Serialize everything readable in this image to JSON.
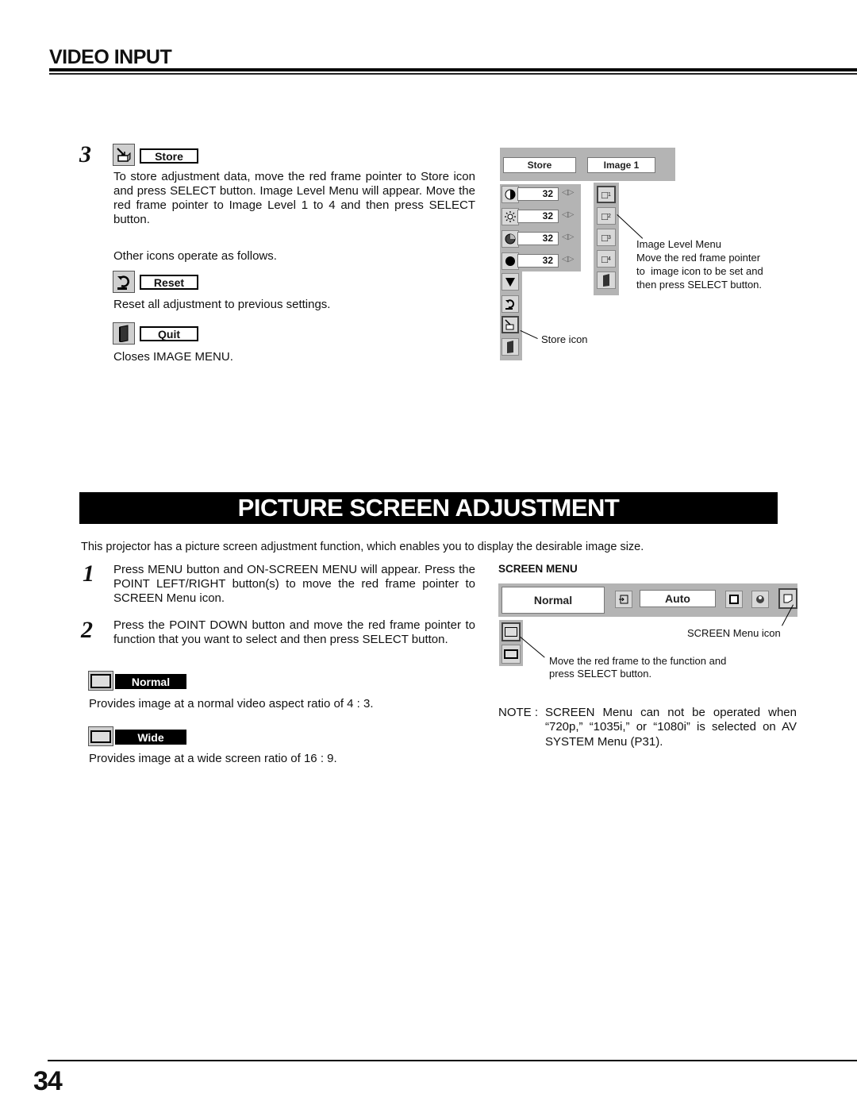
{
  "header": {
    "section_title": "VIDEO INPUT"
  },
  "store_section": {
    "step_number": "3",
    "store": {
      "icon": "store-box-icon",
      "label": "Store",
      "description": "To store adjustment data, move the red frame pointer to Store icon and press SELECT button.  Image Level Menu will appear. Move the red frame pointer to Image Level 1 to 4 and then press SELECT button."
    },
    "other_icons_intro": "Other icons operate as follows.",
    "reset": {
      "icon": "reset-arrow-icon",
      "label": "Reset",
      "description": "Reset all adjustment to previous settings."
    },
    "quit": {
      "icon": "door-icon",
      "label": "Quit",
      "description": "Closes IMAGE MENU."
    }
  },
  "image_menu_osd": {
    "top_fields": [
      "Store",
      "Image 1"
    ],
    "rows": [
      {
        "icon": "contrast-icon",
        "value": "32"
      },
      {
        "icon": "brightness-icon",
        "value": "32"
      },
      {
        "icon": "color-icon",
        "value": "32"
      },
      {
        "icon": "tint-icon",
        "value": "32"
      }
    ],
    "lower_icons": [
      "down-arrow-icon",
      "reset-arrow-icon",
      "store-box-icon",
      "door-icon"
    ],
    "image_levels": [
      "1",
      "2",
      "3",
      "4"
    ],
    "image_level_caption": {
      "title": "Image Level Menu",
      "lines": [
        "Move the red frame pointer",
        "to  image icon to be set and",
        "then press SELECT button."
      ]
    },
    "store_icon_caption": "Store icon"
  },
  "picture_screen": {
    "banner_title": "PICTURE SCREEN ADJUSTMENT",
    "intro": "This projector has a picture screen adjustment function, which enables you to display the desirable image size.",
    "steps": [
      {
        "number": "1",
        "text": "Press MENU button and ON-SCREEN MENU will appear.  Press the POINT LEFT/RIGHT button(s) to move the red frame pointer to SCREEN Menu icon."
      },
      {
        "number": "2",
        "text": "Press the POINT DOWN button and move the red frame pointer to function that you want to select and then press SELECT button."
      }
    ],
    "modes": [
      {
        "label": "Normal",
        "icon": "normal-screen-icon",
        "description": "Provides image at a normal video aspect ratio of 4 : 3."
      },
      {
        "label": "Wide",
        "icon": "wide-screen-icon",
        "description": "Provides image at a wide screen ratio of 16 : 9."
      }
    ]
  },
  "screen_menu_osd": {
    "heading": "SCREEN MENU",
    "current_mode": "Normal",
    "source_field": "Auto",
    "screen_menu_icon_caption": "SCREEN Menu icon",
    "function_caption": [
      "Move the red frame to the function and",
      "press SELECT button."
    ]
  },
  "note": {
    "prefix": "NOTE :",
    "lines": [
      "SCREEN Menu can not be operated when",
      "“720p,” “1035i,” or “1080i” is selected on AV",
      "SYSTEM Menu (P31)."
    ]
  },
  "footer": {
    "page_number": "34"
  }
}
